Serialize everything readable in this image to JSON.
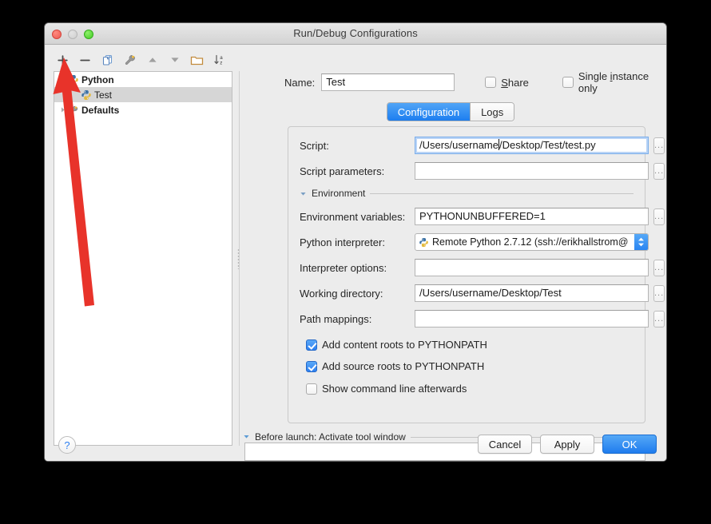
{
  "window": {
    "title": "Run/Debug Configurations",
    "traffic_lights": [
      "close-red",
      "minimize-gray",
      "zoom-green"
    ]
  },
  "toolbar": {
    "buttons": [
      {
        "name": "add-button",
        "icon": "plus-icon",
        "label": "+"
      },
      {
        "name": "remove-button",
        "icon": "minus-icon",
        "label": "−"
      },
      {
        "name": "copy-button",
        "icon": "copy-icon",
        "label": "Copy Configuration"
      },
      {
        "name": "edit-defaults-button",
        "icon": "wrench-icon",
        "label": "Edit defaults"
      },
      {
        "name": "move-up-button",
        "icon": "arrow-up-icon",
        "label": "Move Up"
      },
      {
        "name": "move-down-button",
        "icon": "arrow-down-icon",
        "label": "Move Down"
      },
      {
        "name": "folder-button",
        "icon": "folder-icon",
        "label": "Create new folder"
      },
      {
        "name": "sort-button",
        "icon": "sort-az-icon",
        "label": "Sort configurations"
      }
    ]
  },
  "tree": {
    "items": [
      {
        "label": "Python",
        "icon": "python-icon",
        "twisty": "expanded",
        "bold": true,
        "selected": false,
        "indent": 0
      },
      {
        "label": "Test",
        "icon": "python-icon",
        "twisty": "none",
        "bold": false,
        "selected": true,
        "indent": 1
      },
      {
        "label": "Defaults",
        "icon": "wrench-icon",
        "twisty": "collapsed",
        "bold": true,
        "selected": false,
        "indent": 0
      }
    ]
  },
  "name_row": {
    "label": "Name:",
    "value": "Test",
    "placeholder": "",
    "share": {
      "label": "Share",
      "underline_index": 0,
      "checked": false
    },
    "single_instance": {
      "label": "Single instance only",
      "underline_index": 7,
      "checked": false
    }
  },
  "tabs": {
    "items": [
      {
        "label": "Configuration",
        "active": true
      },
      {
        "label": "Logs",
        "active": false
      }
    ]
  },
  "config": {
    "fields": [
      {
        "label": "Script:",
        "value": "/Users/username/Desktop/Test/test.py",
        "focused": true,
        "caret_after": "/Users/username",
        "browse": "..."
      },
      {
        "label": "Script parameters:",
        "value": "",
        "focused": false,
        "browse": "..."
      },
      {
        "label": "Environment variables:",
        "value": "PYTHONUNBUFFERED=1",
        "focused": false,
        "browse": "..."
      },
      {
        "label": "Interpreter options:",
        "value": "",
        "focused": false,
        "browse": "..."
      },
      {
        "label": "Working directory:",
        "value": "/Users/username/Desktop/Test",
        "focused": false,
        "browse": "..."
      },
      {
        "label": "Path mappings:",
        "value": "",
        "focused": false,
        "browse": "..."
      }
    ],
    "environment_section": {
      "title": "Environment",
      "expanded": true
    },
    "interpreter": {
      "label": "Python interpreter:",
      "value": "Remote Python 2.7.12 (ssh://erikhallstrom@",
      "icon": "python-icon"
    },
    "checkboxes": [
      {
        "label": "Add content roots to PYTHONPATH",
        "checked": true
      },
      {
        "label": "Add source roots to PYTHONPATH",
        "checked": true
      },
      {
        "label": "Show command line afterwards",
        "checked": false
      }
    ]
  },
  "before_launch": {
    "title": "Before launch: Activate tool window",
    "expanded": true,
    "list_value": ""
  },
  "footer": {
    "help": "?",
    "cancel": "Cancel",
    "apply": "Apply",
    "ok": "OK"
  },
  "annotation": {
    "arrow_color": "#e8332a",
    "points_to": "add-button"
  },
  "colors": {
    "accent_blue": "#2d7ff0",
    "selection_gray": "#d6d6d6",
    "window_bg": "#ececec",
    "annotation_red": "#e8332a"
  }
}
